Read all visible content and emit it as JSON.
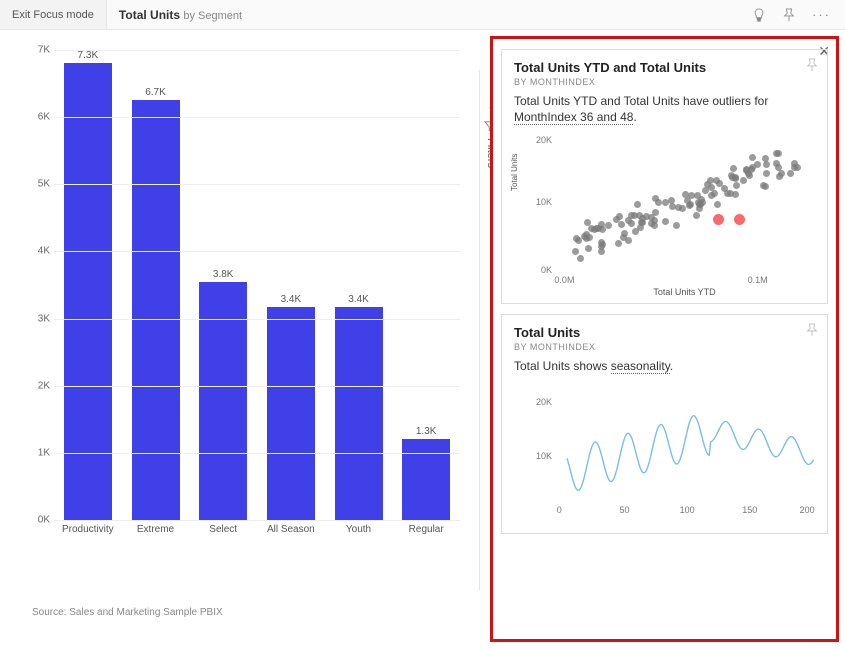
{
  "header": {
    "exit_focus": "Exit Focus mode",
    "title_main": "Total Units",
    "title_sub": "by Segment"
  },
  "filters": {
    "label": "Filters"
  },
  "source": "Source: Sales and Marketing Sample PBIX",
  "chart_data": {
    "type": "bar",
    "title": "Total Units by Segment",
    "ylabel": "",
    "xlabel": "",
    "ylim": [
      0,
      7500
    ],
    "y_ticks": [
      "0K",
      "1K",
      "2K",
      "3K",
      "4K",
      "5K",
      "6K",
      "7K"
    ],
    "categories": [
      "Productivity",
      "Extreme",
      "Select",
      "All Season",
      "Youth",
      "Regular"
    ],
    "labels": [
      "7.3K",
      "6.7K",
      "3.8K",
      "3.4K",
      "3.4K",
      "1.3K"
    ],
    "values": [
      7300,
      6700,
      3800,
      3400,
      3400,
      1300
    ]
  },
  "insights": {
    "card1": {
      "title": "Total Units YTD and Total Units",
      "subtitle": "BY MONTHINDEX",
      "desc_prefix": "Total Units YTD and Total Units have outliers for ",
      "desc_highlight": "MonthIndex 36 and 48",
      "desc_suffix": ".",
      "y_ticks": [
        "0K",
        "10K",
        "20K"
      ],
      "x_ticks": [
        "0.0M",
        "0.1M"
      ],
      "xlabel": "Total Units YTD",
      "ylabel": "Total Units"
    },
    "card2": {
      "title": "Total Units",
      "subtitle": "BY MONTHINDEX",
      "desc_prefix": "Total Units shows ",
      "desc_highlight": "seasonality",
      "desc_suffix": ".",
      "y_ticks": [
        "10K",
        "20K"
      ],
      "x_ticks": [
        "0",
        "50",
        "100",
        "150",
        "200"
      ]
    }
  }
}
